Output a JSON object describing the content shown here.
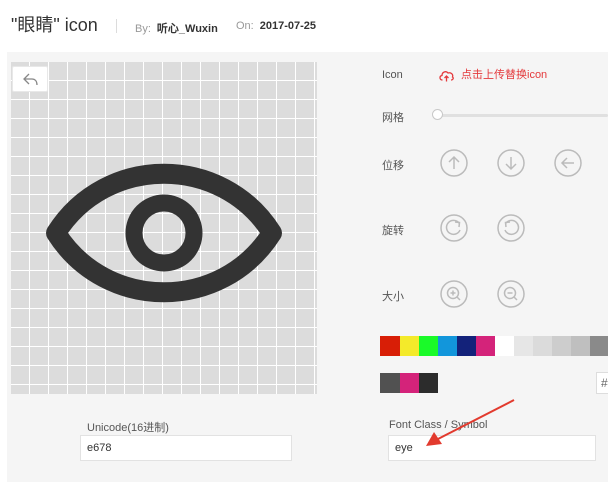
{
  "header": {
    "title": "\"眼睛\" icon",
    "by_label": "By:",
    "author": "听心_Wuxin",
    "on_label": "On:",
    "date": "2017-07-25"
  },
  "controls": {
    "icon_label": "Icon",
    "upload_label": "点击上传替换icon",
    "grid_label": "网格",
    "move_label": "位移",
    "rotate_label": "旋转",
    "size_label": "大小",
    "hex_prefix": "#"
  },
  "palette": {
    "row1": [
      "#d81e06",
      "#f4ea2a",
      "#1afa29",
      "#1296db",
      "#13227a",
      "#d4237a",
      "#ffffff",
      "#e6e6e6",
      "#dbdbdb",
      "#cdcdcd",
      "#bfbfbf",
      "#8a8a8a"
    ],
    "row2": [
      "#515151",
      "#d4237a",
      "#2c2c2c"
    ]
  },
  "fields": {
    "unicode_label": "Unicode(16进制)",
    "unicode_value": "e678",
    "fontclass_label": "Font Class / Symbol",
    "fontclass_value": "eye"
  },
  "colors": {
    "accent": "#e4393c",
    "icon_fill": "#333333",
    "annotation": "#e23a2e"
  },
  "icons": [
    "undo-icon",
    "cloud-upload-icon",
    "arrow-up-icon",
    "arrow-down-icon",
    "arrow-left-icon",
    "rotate-clockwise-icon",
    "rotate-counterclockwise-icon",
    "zoom-in-icon",
    "zoom-out-icon",
    "eye-icon"
  ]
}
